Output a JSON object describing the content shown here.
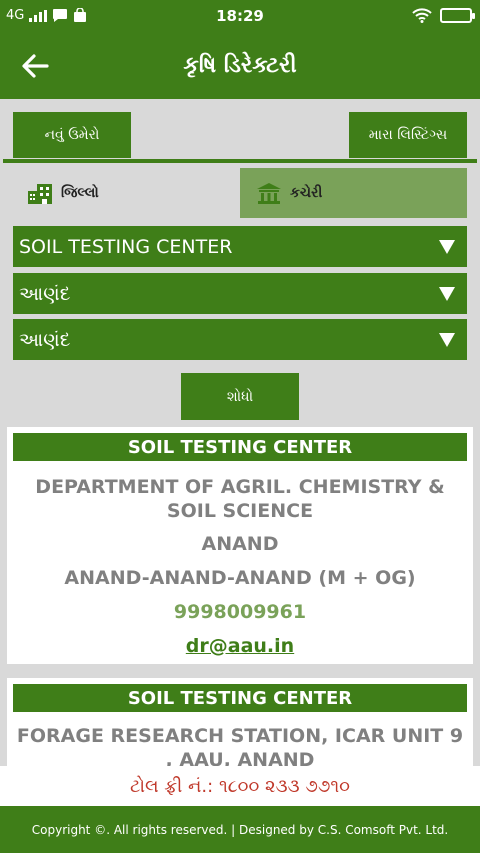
{
  "status_bar": {
    "network": "4G",
    "time": "18:29"
  },
  "app_bar": {
    "title": "કૃષિ ડિરેક્ટરી"
  },
  "buttons": {
    "new_add": "નવું ઉમેરો",
    "my_listings": "મારા લિસ્ટિંગ્સ",
    "search": "શોધો"
  },
  "tabs": [
    {
      "label": "જિલ્લો",
      "icon": "building-icon",
      "selected": false
    },
    {
      "label": "કચેરી",
      "icon": "institution-icon",
      "selected": true
    }
  ],
  "filters": {
    "category": "SOIL TESTING CENTER",
    "district": "આણંદ",
    "taluka": "આણંદ"
  },
  "results": [
    {
      "title": "SOIL TESTING CENTER",
      "department": "DEPARTMENT OF AGRIL. CHEMISTRY & SOIL SCIENCE",
      "city": "ANAND",
      "area": "ANAND-ANAND-ANAND (M + OG)",
      "phone": "9998009961",
      "email": "dr@aau.in"
    },
    {
      "title": "SOIL TESTING CENTER",
      "department": "FORAGE RESEARCH STATION, ICAR UNIT 9 , AAU, ANAND"
    }
  ],
  "toll_free": "ટોલ ફ્રી નં.: ૧૮૦૦ ૨૩૩ ૭૭૧૦",
  "footer": "Copyright ©. All rights reserved. | Designed by C.S. Comsoft Pvt. Ltd.",
  "colors": {
    "primary": "#3f7e18",
    "tab_selected": "#7aa259",
    "background": "#d9d9d9",
    "toll_free_text": "#c0392b",
    "muted_text": "#808080"
  }
}
